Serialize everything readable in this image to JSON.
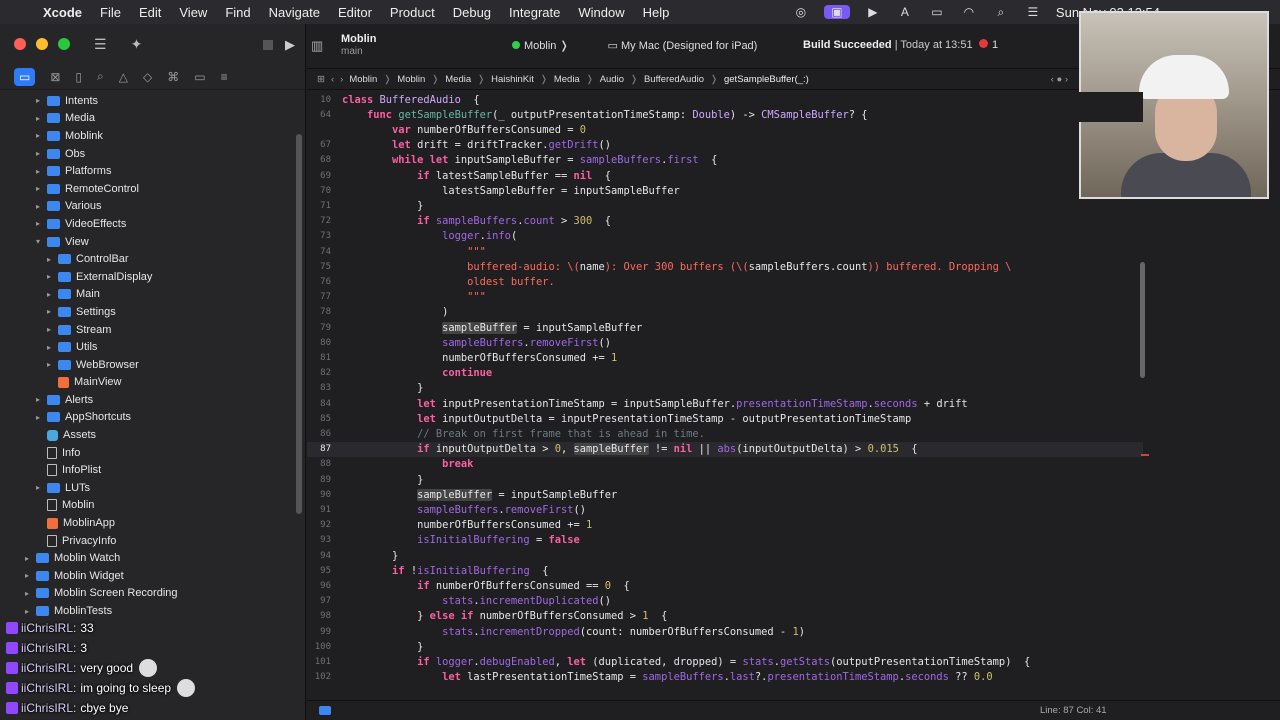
{
  "menubar": {
    "app": "Xcode",
    "items": [
      "File",
      "Edit",
      "View",
      "Find",
      "Navigate",
      "Editor",
      "Product",
      "Debug",
      "Integrate",
      "Window",
      "Help"
    ],
    "clock": "Sun Nov 03 13:54"
  },
  "toolbar": {
    "project_name": "Moblin",
    "branch": "main",
    "scheme": "Moblin",
    "destination": "My Mac (Designed for iPad)",
    "status_bold": "Build Succeeded",
    "status_time": "Today at 13:51",
    "error_count": "1"
  },
  "jumpbar": {
    "crumbs": [
      "Moblin",
      "Moblin",
      "Media",
      "HaishinKit",
      "Media",
      "Audio",
      "BufferedAudio",
      "getSampleBuffer(_:)"
    ]
  },
  "sidebar": {
    "tabs": [
      "folder-icon",
      "source-control-icon",
      "bookmark-icon",
      "find-icon",
      "issue-icon",
      "test-icon",
      "debug-icon",
      "breakpoint-icon",
      "report-icon"
    ],
    "items": [
      {
        "label": "Intents",
        "depth": 1,
        "kind": "folder",
        "disc": "▸"
      },
      {
        "label": "Media",
        "depth": 1,
        "kind": "folder",
        "disc": "▸"
      },
      {
        "label": "Moblink",
        "depth": 1,
        "kind": "folder",
        "disc": "▸"
      },
      {
        "label": "Obs",
        "depth": 1,
        "kind": "folder",
        "disc": "▸"
      },
      {
        "label": "Platforms",
        "depth": 1,
        "kind": "folder",
        "disc": "▸"
      },
      {
        "label": "RemoteControl",
        "depth": 1,
        "kind": "folder",
        "disc": "▸"
      },
      {
        "label": "Various",
        "depth": 1,
        "kind": "folder",
        "disc": "▸"
      },
      {
        "label": "VideoEffects",
        "depth": 1,
        "kind": "folder",
        "disc": "▸"
      },
      {
        "label": "View",
        "depth": 1,
        "kind": "folder",
        "disc": "▾"
      },
      {
        "label": "ControlBar",
        "depth": 2,
        "kind": "folder",
        "disc": "▸"
      },
      {
        "label": "ExternalDisplay",
        "depth": 2,
        "kind": "folder",
        "disc": "▸"
      },
      {
        "label": "Main",
        "depth": 2,
        "kind": "folder",
        "disc": "▸"
      },
      {
        "label": "Settings",
        "depth": 2,
        "kind": "folder",
        "disc": "▸"
      },
      {
        "label": "Stream",
        "depth": 2,
        "kind": "folder",
        "disc": "▸"
      },
      {
        "label": "Utils",
        "depth": 2,
        "kind": "folder",
        "disc": "▸"
      },
      {
        "label": "WebBrowser",
        "depth": 2,
        "kind": "folder",
        "disc": "▸"
      },
      {
        "label": "MainView",
        "depth": 2,
        "kind": "swift",
        "disc": ""
      },
      {
        "label": "Alerts",
        "depth": 1,
        "kind": "folder",
        "disc": "▸"
      },
      {
        "label": "AppShortcuts",
        "depth": 1,
        "kind": "folder",
        "disc": "▸"
      },
      {
        "label": "Assets",
        "depth": 1,
        "kind": "asset",
        "disc": ""
      },
      {
        "label": "Info",
        "depth": 1,
        "kind": "file",
        "disc": ""
      },
      {
        "label": "InfoPlist",
        "depth": 1,
        "kind": "file",
        "disc": ""
      },
      {
        "label": "LUTs",
        "depth": 1,
        "kind": "folder",
        "disc": "▸"
      },
      {
        "label": "Moblin",
        "depth": 1,
        "kind": "file",
        "disc": ""
      },
      {
        "label": "MoblinApp",
        "depth": 1,
        "kind": "swift",
        "disc": ""
      },
      {
        "label": "PrivacyInfo",
        "depth": 1,
        "kind": "file",
        "disc": ""
      },
      {
        "label": "Moblin Watch",
        "depth": 0,
        "kind": "folder",
        "disc": "▸"
      },
      {
        "label": "Moblin Widget",
        "depth": 0,
        "kind": "folder",
        "disc": "▸"
      },
      {
        "label": "Moblin Screen Recording",
        "depth": 0,
        "kind": "folder",
        "disc": "▸"
      },
      {
        "label": "MoblinTests",
        "depth": 0,
        "kind": "folder",
        "disc": "▸"
      }
    ]
  },
  "chat": [
    {
      "user": "iiChrisIRL:",
      "msg": "33",
      "emote": false
    },
    {
      "user": "iiChrisIRL:",
      "msg": "3",
      "emote": false
    },
    {
      "user": "iiChrisIRL:",
      "msg": "very good",
      "emote": true
    },
    {
      "user": "iiChrisIRL:",
      "msg": "im going to sleep",
      "emote": true
    },
    {
      "user": "iiChrisIRL:",
      "msg": "cbye bye",
      "emote": false
    }
  ],
  "code": {
    "current_line": "87",
    "lines": [
      {
        "n": "10",
        "t": [
          [
            "kw",
            "class "
          ],
          [
            "tp",
            "BufferedAudio"
          ],
          [
            "",
            "  {"
          ]
        ],
        "sticky": true
      },
      {
        "n": "64",
        "t": [
          [
            "",
            "    "
          ],
          [
            "kw",
            "func "
          ],
          [
            "fn",
            "getSampleBuffer"
          ],
          [
            "",
            "(_ outputPresentationTimeStamp: "
          ],
          [
            "tp",
            "Double"
          ],
          [
            "",
            ") -> "
          ],
          [
            "tp",
            "CMSampleBuffer"
          ],
          [
            "",
            "? {"
          ]
        ],
        "sticky": true
      },
      {
        "n": "",
        "t": [
          [
            "",
            "        "
          ],
          [
            "kw",
            "var "
          ],
          [
            "",
            "numberOfBuffersConsumed = "
          ],
          [
            "nm",
            "0"
          ]
        ]
      },
      {
        "n": "67",
        "t": [
          [
            "",
            "        "
          ],
          [
            "kw",
            "let "
          ],
          [
            "",
            "drift = "
          ],
          [
            "",
            "driftTracker."
          ],
          [
            "pr",
            "getDrift"
          ],
          [
            "",
            "()"
          ]
        ]
      },
      {
        "n": "68",
        "t": [
          [
            "",
            "        "
          ],
          [
            "kw",
            "while let "
          ],
          [
            "",
            "inputSampleBuffer = "
          ],
          [
            "pr",
            "sampleBuffers"
          ],
          [
            "",
            "."
          ],
          [
            "pr",
            "first"
          ],
          [
            "",
            ""
          ],
          [
            "",
            "  {"
          ]
        ]
      },
      {
        "n": "69",
        "t": [
          [
            "",
            "            "
          ],
          [
            "kw",
            "if "
          ],
          [
            "",
            "latestSampleBuffer == "
          ],
          [
            "kw",
            "nil"
          ],
          [
            "",
            "  {"
          ]
        ]
      },
      {
        "n": "70",
        "t": [
          [
            "",
            "                latestSampleBuffer = inputSampleBuffer"
          ]
        ]
      },
      {
        "n": "71",
        "t": [
          [
            "",
            "            }"
          ]
        ]
      },
      {
        "n": "72",
        "t": [
          [
            "",
            "            "
          ],
          [
            "kw",
            "if "
          ],
          [
            "pr",
            "sampleBuffers"
          ],
          [
            "",
            "."
          ],
          [
            "pr",
            "count"
          ],
          [
            "",
            ""
          ],
          [
            "",
            " > "
          ],
          [
            "nm",
            "300"
          ],
          [
            "",
            "  {"
          ]
        ]
      },
      {
        "n": "73",
        "t": [
          [
            "",
            "                "
          ],
          [
            "pr",
            "logger"
          ],
          [
            "",
            "."
          ],
          [
            "pr",
            "info"
          ],
          [
            "",
            "("
          ]
        ]
      },
      {
        "n": "74",
        "t": [
          [
            "",
            "                    "
          ],
          [
            "st",
            "\"\"\""
          ]
        ]
      },
      {
        "n": "75",
        "t": [
          [
            "",
            "                    "
          ],
          [
            "st",
            "buffered-audio: \\("
          ],
          [
            "",
            "name"
          ],
          [
            "st",
            "): Over 300 buffers (\\("
          ],
          [
            "",
            "sampleBuffers.count"
          ],
          [
            "st",
            ")) buffered. Dropping \\"
          ]
        ]
      },
      {
        "n": "76",
        "t": [
          [
            "",
            "                    "
          ],
          [
            "st",
            "oldest buffer."
          ]
        ]
      },
      {
        "n": "77",
        "t": [
          [
            "",
            "                    "
          ],
          [
            "st",
            "\"\"\""
          ]
        ]
      },
      {
        "n": "78",
        "t": [
          [
            "",
            "                )"
          ]
        ]
      },
      {
        "n": "79",
        "t": [
          [
            "",
            "                "
          ],
          [
            "hl",
            "sampleBuffer"
          ],
          [
            "",
            " = inputSampleBuffer"
          ]
        ]
      },
      {
        "n": "80",
        "t": [
          [
            "",
            "                "
          ],
          [
            "pr",
            "sampleBuffers"
          ],
          [
            "",
            "."
          ],
          [
            "pr",
            "removeFirst"
          ],
          [
            "",
            "()"
          ]
        ]
      },
      {
        "n": "81",
        "t": [
          [
            "",
            "                numberOfBuffersConsumed += "
          ],
          [
            "nm",
            "1"
          ]
        ]
      },
      {
        "n": "82",
        "t": [
          [
            "",
            "                "
          ],
          [
            "kw",
            "continue"
          ]
        ]
      },
      {
        "n": "83",
        "t": [
          [
            "",
            "            }"
          ]
        ]
      },
      {
        "n": "84",
        "t": [
          [
            "",
            "            "
          ],
          [
            "kw",
            "let "
          ],
          [
            "",
            "inputPresentationTimeStamp = inputSampleBuffer."
          ],
          [
            "pr",
            "presentationTimeStamp"
          ],
          [
            "",
            "."
          ],
          [
            "pr",
            "seconds"
          ],
          [
            "",
            " + drift"
          ]
        ]
      },
      {
        "n": "85",
        "t": [
          [
            "",
            "            "
          ],
          [
            "kw",
            "let "
          ],
          [
            "",
            "inputOutputDelta = inputPresentationTimeStamp - outputPresentationTimeStamp"
          ]
        ]
      },
      {
        "n": "86",
        "t": [
          [
            "",
            "            "
          ],
          [
            "cm",
            "// Break on first frame that is ahead in time."
          ]
        ]
      },
      {
        "n": "87",
        "t": [
          [
            "",
            "            "
          ],
          [
            "kw",
            "if "
          ],
          [
            "",
            "inputOutputDelta > "
          ],
          [
            "nm",
            "0"
          ],
          [
            "",
            ", "
          ],
          [
            "hl",
            "sampleBuffer"
          ],
          [
            "",
            " != "
          ],
          [
            "kw",
            "nil"
          ],
          [
            "",
            " || "
          ],
          [
            "pr",
            "abs"
          ],
          [
            "",
            "(inputOutputDelta) > "
          ],
          [
            "nm",
            "0.015"
          ],
          [
            "",
            "  {"
          ]
        ],
        "cur": true
      },
      {
        "n": "88",
        "t": [
          [
            "",
            "                "
          ],
          [
            "kw",
            "break"
          ]
        ]
      },
      {
        "n": "89",
        "t": [
          [
            "",
            "            }"
          ]
        ]
      },
      {
        "n": "90",
        "t": [
          [
            "",
            "            "
          ],
          [
            "hl",
            "sampleBuffer"
          ],
          [
            "",
            " = inputSampleBuffer"
          ]
        ]
      },
      {
        "n": "91",
        "t": [
          [
            "",
            "            "
          ],
          [
            "pr",
            "sampleBuffers"
          ],
          [
            "",
            "."
          ],
          [
            "pr",
            "removeFirst"
          ],
          [
            "",
            "()"
          ]
        ]
      },
      {
        "n": "92",
        "t": [
          [
            "",
            "            numberOfBuffersConsumed += "
          ],
          [
            "nm",
            "1"
          ]
        ]
      },
      {
        "n": "93",
        "t": [
          [
            "",
            "            "
          ],
          [
            "pr",
            "isInitialBuffering"
          ],
          [
            "",
            " = "
          ],
          [
            "kw",
            "false"
          ]
        ]
      },
      {
        "n": "94",
        "t": [
          [
            "",
            "        }"
          ]
        ]
      },
      {
        "n": "95",
        "t": [
          [
            "",
            "        "
          ],
          [
            "kw",
            "if "
          ],
          [
            "",
            "!"
          ],
          [
            "pr",
            "isInitialBuffering"
          ],
          [
            "",
            "  {"
          ]
        ]
      },
      {
        "n": "96",
        "t": [
          [
            "",
            "            "
          ],
          [
            "kw",
            "if "
          ],
          [
            "",
            "numberOfBuffersConsumed == "
          ],
          [
            "nm",
            "0"
          ],
          [
            "",
            "  {"
          ]
        ]
      },
      {
        "n": "97",
        "t": [
          [
            "",
            "                "
          ],
          [
            "pr",
            "stats"
          ],
          [
            "",
            "."
          ],
          [
            "pr",
            "incrementDuplicated"
          ],
          [
            "",
            "()"
          ]
        ]
      },
      {
        "n": "98",
        "t": [
          [
            "",
            "            } "
          ],
          [
            "kw",
            "else if "
          ],
          [
            "",
            "numberOfBuffersConsumed > "
          ],
          [
            "nm",
            "1"
          ],
          [
            "",
            "  {"
          ]
        ]
      },
      {
        "n": "99",
        "t": [
          [
            "",
            "                "
          ],
          [
            "pr",
            "stats"
          ],
          [
            "",
            "."
          ],
          [
            "pr",
            "incrementDropped"
          ],
          [
            "",
            "(count: numberOfBuffersConsumed - "
          ],
          [
            "nm",
            "1"
          ],
          [
            "",
            ")"
          ]
        ]
      },
      {
        "n": "100",
        "t": [
          [
            "",
            "            }"
          ]
        ]
      },
      {
        "n": "101",
        "t": [
          [
            "",
            "            "
          ],
          [
            "kw",
            "if "
          ],
          [
            "pr",
            "logger"
          ],
          [
            "",
            "."
          ],
          [
            "pr",
            "debugEnabled"
          ],
          [
            "",
            ", "
          ],
          [
            "kw",
            "let "
          ],
          [
            "",
            "(duplicated, dropped) = "
          ],
          [
            "pr",
            "stats"
          ],
          [
            "",
            "."
          ],
          [
            "pr",
            "getStats"
          ],
          [
            "",
            "(outputPresentationTimeStamp)  {"
          ]
        ]
      },
      {
        "n": "102",
        "t": [
          [
            "",
            "                "
          ],
          [
            "kw",
            "let "
          ],
          [
            "",
            "lastPresentationTimeStamp = "
          ],
          [
            "pr",
            "sampleBuffers"
          ],
          [
            "",
            "."
          ],
          [
            "pr",
            "last"
          ],
          [
            "",
            "?."
          ],
          [
            "pr",
            "presentationTimeStamp"
          ],
          [
            "",
            "."
          ],
          [
            "pr",
            "seconds"
          ],
          [
            "",
            " ?? "
          ],
          [
            "nm",
            "0.0"
          ]
        ]
      }
    ]
  },
  "statusbar": {
    "position": "Line: 87  Col: 41"
  }
}
